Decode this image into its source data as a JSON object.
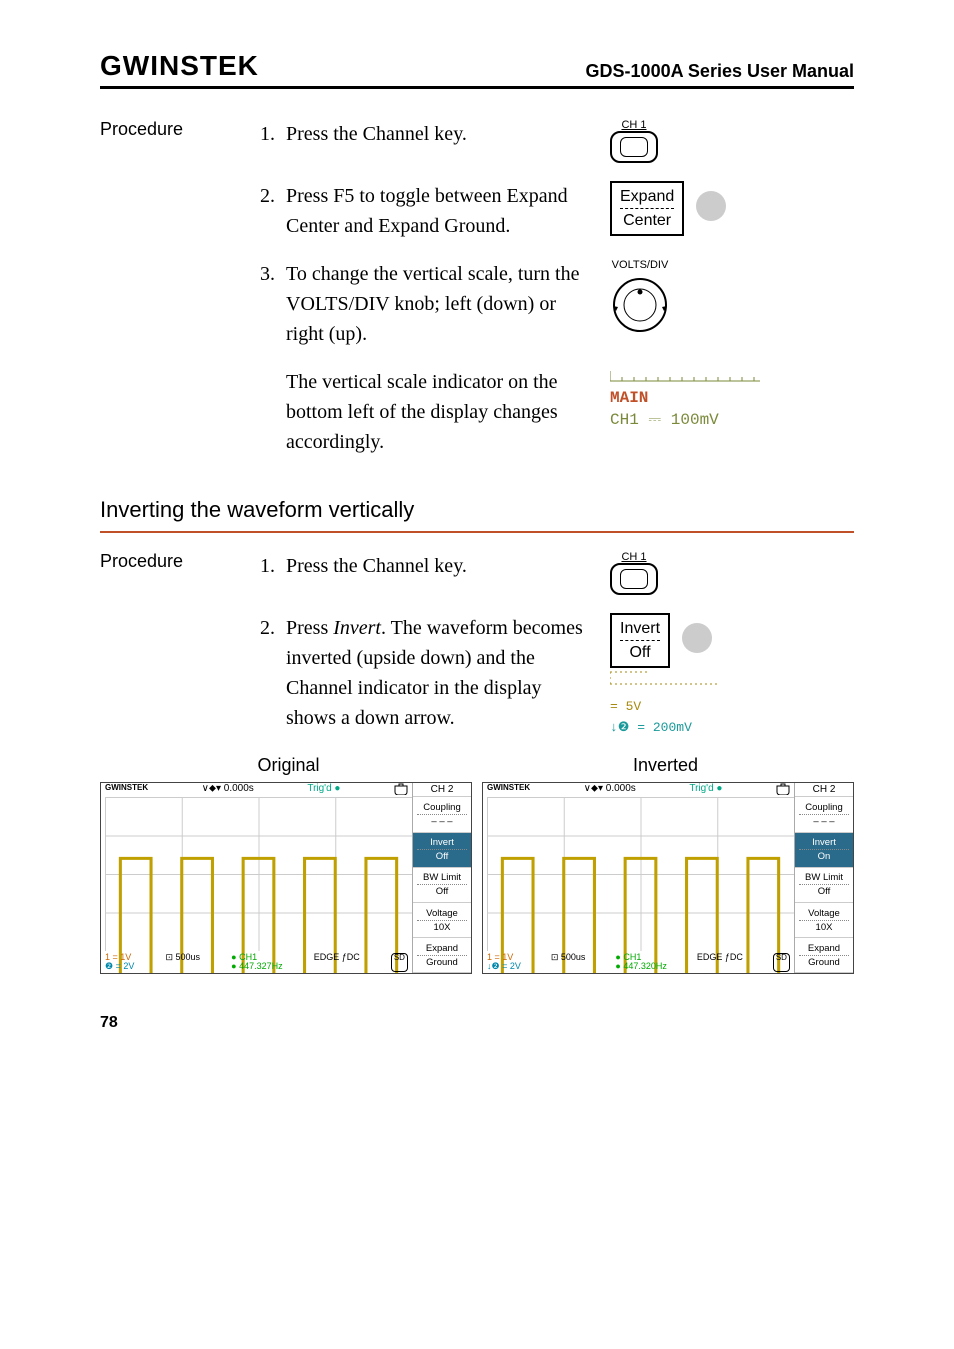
{
  "header": {
    "logo": "GWINSTEK",
    "title": "GDS-1000A Series User Manual"
  },
  "proc1": {
    "label": "Procedure",
    "step1": {
      "n": "1.",
      "t": "Press the Channel key."
    },
    "key1_label": "CH 1",
    "step2": {
      "n": "2.",
      "t": "Press F5 to toggle between Expand Center and Expand Ground."
    },
    "soft2_line1": "Expand",
    "soft2_line2": "Center",
    "step3": {
      "n": "3.",
      "t": "To change the vertical scale, turn the VOLTS/DIV knob; left (down) or right (up)."
    },
    "knob_label": "VOLTS/DIV",
    "step4": {
      "t": "The vertical scale indicator on the bottom left of the display changes accordingly."
    },
    "lcd_main": "MAIN",
    "lcd_ch": "CH1 ⎓ 100mV"
  },
  "section2": {
    "heading": "Inverting the waveform vertically"
  },
  "proc2": {
    "label": "Procedure",
    "step1": {
      "n": "1.",
      "t": "Press the Channel key."
    },
    "key1_label": "CH 1",
    "step2": {
      "n": "2.",
      "t_pre": "Press ",
      "t_em": "Invert",
      "t_post": ". The waveform becomes inverted (upside down) and the Channel indicator in the display shows a down arrow."
    },
    "soft2_line1": "Invert",
    "soft2_line2": "Off",
    "mini_l1": "= 5V",
    "mini_l2": "↓❷ = 200mV"
  },
  "shots": {
    "titles": {
      "left": "Original",
      "right": "Inverted"
    },
    "left": {
      "brand": "GWINSTEK",
      "time": "∨⬥▾ 0.000s",
      "trig": "Trig'd ●",
      "bot1a": "1 = 1V",
      "bot1b": "❷ = 2V",
      "bot2": "⊡ 500us",
      "bot3a": "● CH1",
      "bot3b": "● 447.327Hz",
      "bot4": "EDGE  ƒDC",
      "menu": {
        "header": "CH 2",
        "m1a": "Coupling",
        "m1b": "– – –",
        "m2a": "Invert",
        "m2b": "Off",
        "m3a": "BW Limit",
        "m3b": "Off",
        "m4a": "Voltage",
        "m4b": "10X",
        "m5a": "Expand",
        "m5b": "Ground"
      }
    },
    "right": {
      "brand": "GWINSTEK",
      "time": "∨⬥▾ 0.000s",
      "trig": "Trig'd ●",
      "bot1a": "1 = 1V",
      "bot1b": "↓❷ = 2V",
      "bot2": "⊡ 500us",
      "bot3a": "● CH1",
      "bot3b": "● 447.320Hz",
      "bot4": "EDGE  ƒDC",
      "menu": {
        "header": "CH 2",
        "m1a": "Coupling",
        "m1b": "– – –",
        "m2a": "Invert",
        "m2b": "On",
        "m3a": "BW Limit",
        "m3b": "Off",
        "m4a": "Voltage",
        "m4b": "10X",
        "m5a": "Expand",
        "m5b": "Ground"
      }
    }
  },
  "page_number": "78"
}
